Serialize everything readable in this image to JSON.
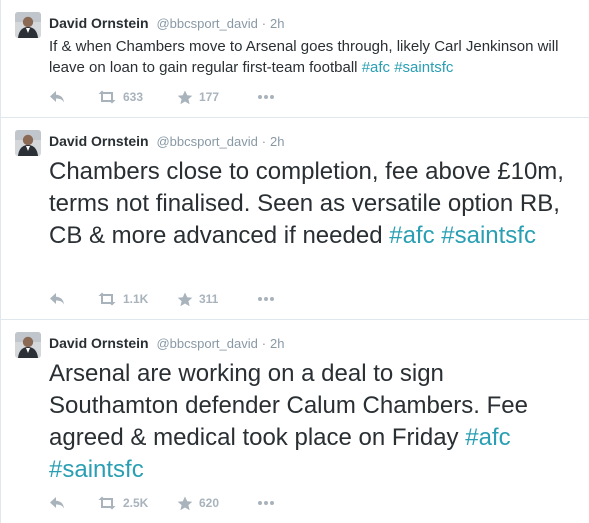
{
  "tweets": [
    {
      "author": "David Ornstein",
      "handle": "@bbcsport_david",
      "separator": "·",
      "time": "2h",
      "text": "If & when Chambers move to Arsenal goes through, likely Carl Jenkinson will leave on loan to gain regular first-team football",
      "hashtags": [
        "#afc",
        "#saintsfc"
      ],
      "retweets": "633",
      "favorites": "177"
    },
    {
      "author": "David Ornstein",
      "handle": "@bbcsport_david",
      "separator": "·",
      "time": "2h",
      "text": "Chambers close to completion, fee above £10m, terms not finalised. Seen as versatile option RB, CB & more advanced if needed",
      "hashtags": [
        "#afc",
        "#saintsfc"
      ],
      "retweets": "1.1K",
      "favorites": "311"
    },
    {
      "author": "David Ornstein",
      "handle": "@bbcsport_david",
      "separator": "·",
      "time": "2h",
      "text": "Arsenal are working on a deal to sign Southamton defender Calum Chambers. Fee agreed & medical took place on Friday",
      "hashtags": [
        "#afc",
        "#saintsfc"
      ],
      "retweets": "2.5K",
      "favorites": "620"
    }
  ],
  "colors": {
    "name": "#292f33",
    "meta": "#8899a6",
    "hashtag": "#2a9fb3",
    "action_icon": "#a8b3bc",
    "divider": "#e1e8ed"
  },
  "icons": {
    "reply": "reply-arrow-icon",
    "retweet": "retweet-icon",
    "favorite": "star-icon",
    "more": "more-dots-icon"
  }
}
